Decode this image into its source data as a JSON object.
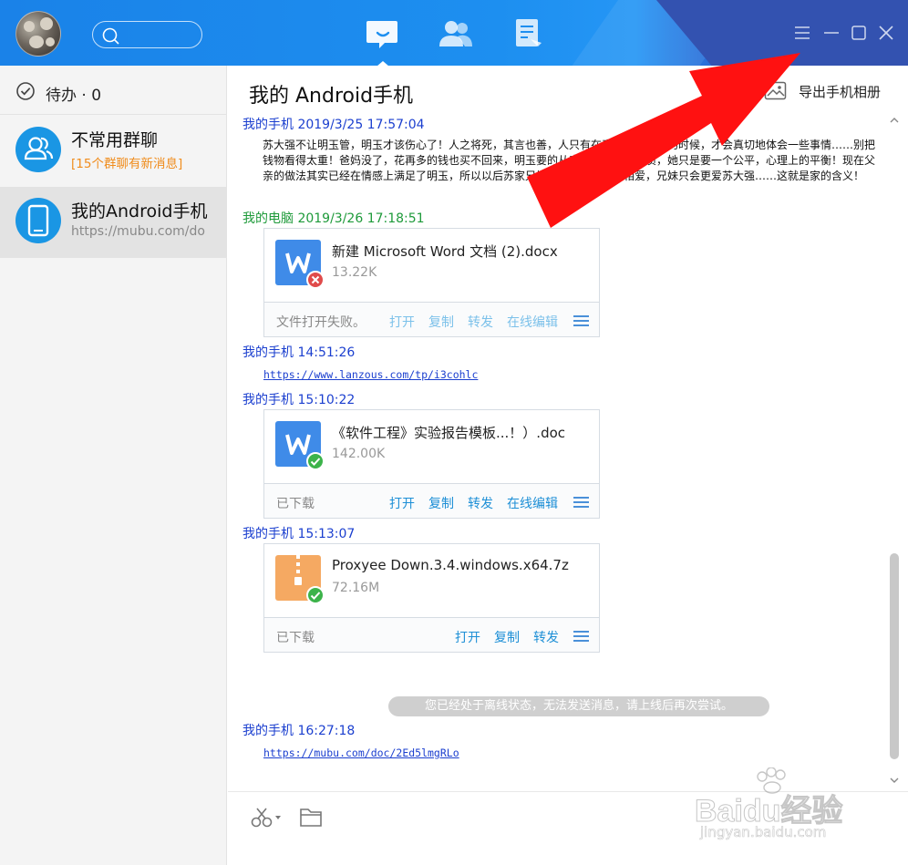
{
  "header": {
    "nav_tabs": [
      {
        "name": "messages",
        "icon": "chat-icon",
        "active": true
      },
      {
        "name": "contacts",
        "icon": "contacts-icon",
        "active": false
      },
      {
        "name": "files",
        "icon": "document-icon",
        "active": false
      }
    ],
    "window_controls": [
      "menu-icon",
      "minimize-icon",
      "maximize-icon",
      "close-icon"
    ],
    "colors": {
      "bar": "#1d8ff0",
      "accent_dark": "#3352b0"
    }
  },
  "sidebar": {
    "todo_label": "待办 · 0",
    "conversations": [
      {
        "title": "不常用群聊",
        "subtitle": "[15个群聊有新消息]",
        "icon": "group-icon",
        "selected": false
      },
      {
        "title": "我的Android手机",
        "subtitle": "https://mubu.com/do",
        "icon": "phone-icon",
        "selected": true
      }
    ]
  },
  "chat": {
    "title": "我的 Android手机",
    "export_label": "导出手机相册",
    "messages": [
      {
        "sender": "我的手机 2019/3/25 17:57:04",
        "text": "苏大强不让明玉管，明玉才该伤心了！人之将死，其言也善，人只有在真正面临死亡的时候，才会真切地体会一些事情……别把钱物看得太重！爸妈没了，花再多的钱也买不回来，明玉要的从来都不是这些物质，她只是要一个公平，心理上的平衡！现在父亲的做法其实已经在情感上满足了明玉，所以以后苏家兄妹只会越来越相亲相爱，兄妹只会更爱苏大强……这就是家的含义！"
      },
      {
        "sender": "我的电脑 2019/3/26 17:18:51",
        "file": {
          "name": "新建 Microsoft Word 文档 (2).docx",
          "size": "13.22K",
          "status": "文件打开失败。",
          "result": "failed",
          "actions": [
            "打开",
            "复制",
            "转发",
            "在线编辑"
          ]
        }
      },
      {
        "sender": "我的手机  14:51:26",
        "link": "https://www.lanzous.com/tp/i3cohlc"
      },
      {
        "sender": "我的手机  15:10:22",
        "file": {
          "name": "《软件工程》实验报告模板...！）.doc",
          "size": "142.00K",
          "status": "已下载",
          "result": "ok",
          "actions": [
            "打开",
            "复制",
            "转发",
            "在线编辑"
          ]
        }
      },
      {
        "sender": "我的手机  15:13:07",
        "file": {
          "name": "Proxyee Down.3.4.windows.x64.7z",
          "size": "72.16M",
          "status": "已下载",
          "result": "ok",
          "actions": [
            "打开",
            "复制",
            "转发"
          ]
        }
      },
      {
        "system": "您已经处于离线状态，无法发送消息，请上线后再次尝试。"
      },
      {
        "sender": "我的手机  16:27:18",
        "link": "https://mubu.com/doc/2Ed5lmgRLo"
      }
    ]
  },
  "toolbar": {
    "tools": [
      "scissors-icon",
      "folder-icon"
    ]
  },
  "watermark": {
    "brand": "Baidu经验",
    "url": "jingyan.baidu.com"
  }
}
